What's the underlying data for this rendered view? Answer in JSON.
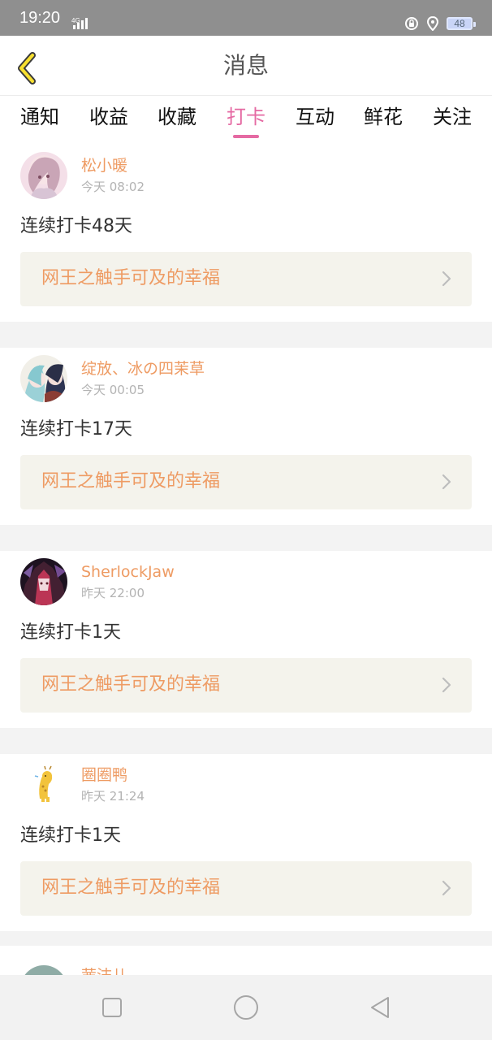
{
  "status_bar": {
    "time": "19:20",
    "network": "4G",
    "battery": "48"
  },
  "header": {
    "title": "消息"
  },
  "tabs": [
    {
      "label": "通知"
    },
    {
      "label": "收益"
    },
    {
      "label": "收藏"
    },
    {
      "label": "打卡",
      "active": true
    },
    {
      "label": "互动"
    },
    {
      "label": "鲜花"
    },
    {
      "label": "关注"
    }
  ],
  "messages": [
    {
      "username": "松小暖",
      "time": "今天 08:02",
      "streak": "连续打卡48天",
      "novel": "网王之触手可及的幸福",
      "avatar_icon": "anime-avatar-pink"
    },
    {
      "username": "绽放、冰の四茉草",
      "time": "今天 00:05",
      "streak": "连续打卡17天",
      "novel": "网王之触手可及的幸福",
      "avatar_icon": "anime-avatar-duo"
    },
    {
      "username": "SherlockJaw",
      "time": "昨天 22:00",
      "streak": "连续打卡1天",
      "novel": "网王之触手可及的幸福",
      "avatar_icon": "anime-avatar-dark"
    },
    {
      "username": "圈圈鸭",
      "time": "昨天 21:24",
      "streak": "连续打卡1天",
      "novel": "网王之触手可及的幸福",
      "avatar_icon": "giraffe-avatar"
    }
  ],
  "partial_message": {
    "username": "茜沫儿"
  },
  "colors": {
    "accent": "#e56aa3",
    "name": "#ee9b63",
    "card_bg": "#f4f3ec"
  }
}
